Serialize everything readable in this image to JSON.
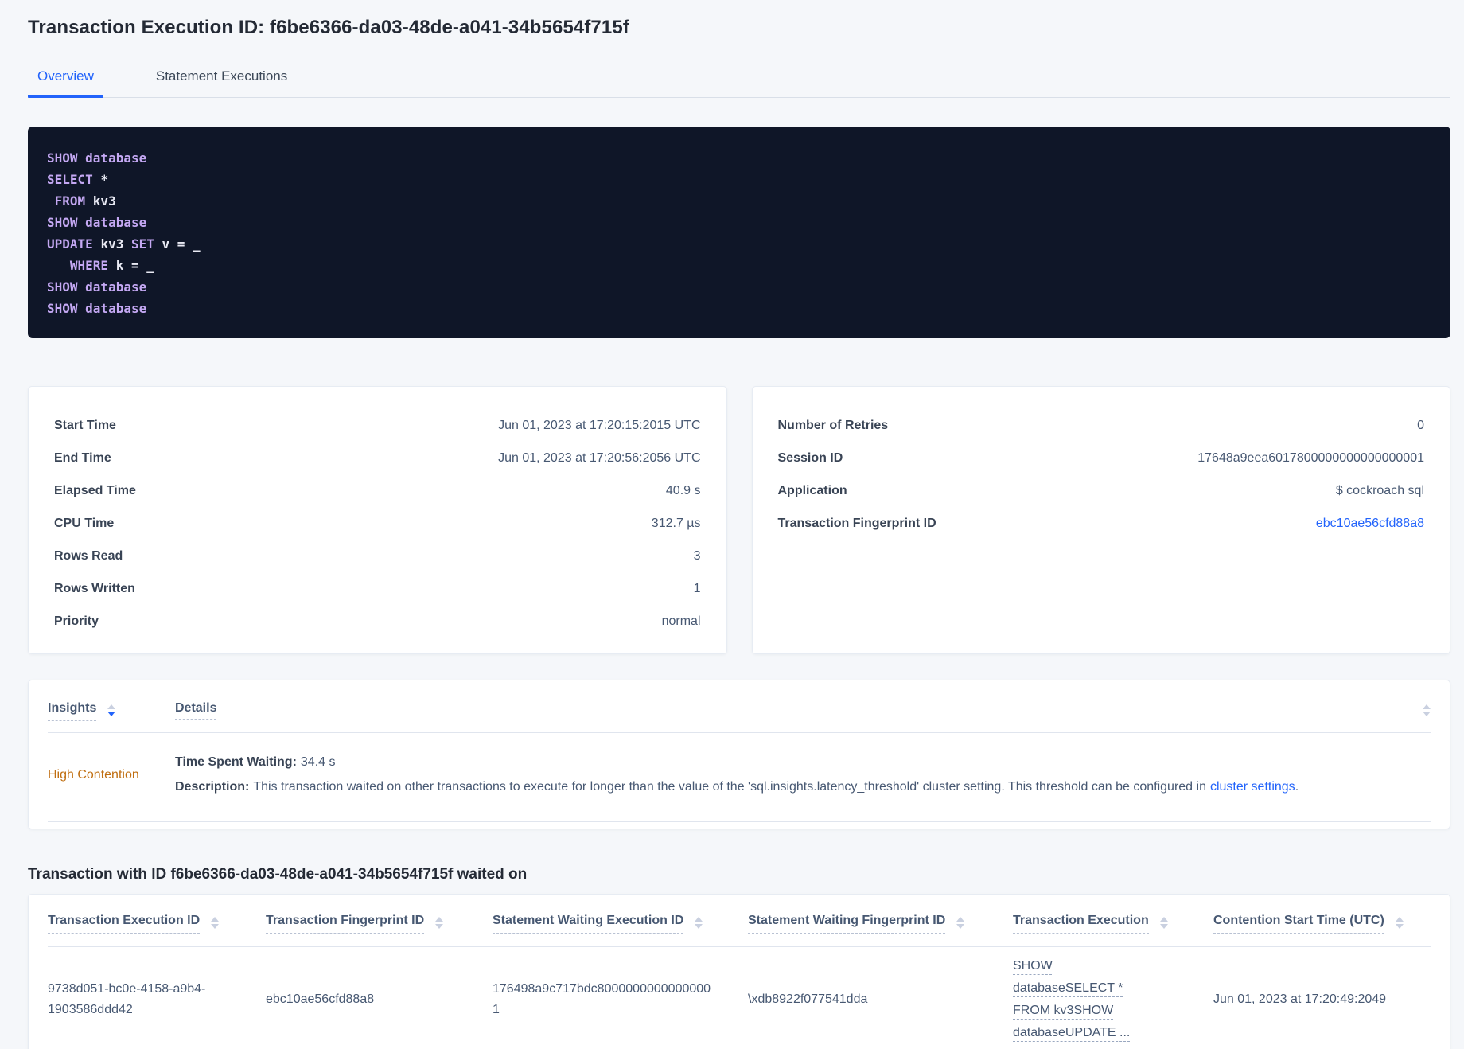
{
  "colors": {
    "accent_blue": "#2263fb",
    "warning_orange": "#c06e10",
    "code_background": "#0f1628",
    "code_keyword": "#c4a8f3",
    "code_text": "#e8e9f3"
  },
  "header": {
    "title": "Transaction Execution ID: f6be6366-da03-48de-a041-34b5654f715f"
  },
  "tabs": [
    {
      "label": "Overview"
    },
    {
      "label": "Statement Executions"
    }
  ],
  "sql": {
    "lines": [
      {
        "parts": [
          {
            "text": "SHOW database"
          }
        ]
      },
      {
        "parts": [
          {
            "text": "SELECT "
          },
          {
            "text": "*"
          }
        ]
      },
      {
        "parts": [
          {
            "text": " FROM "
          },
          {
            "text": "kv3"
          }
        ]
      },
      {
        "parts": [
          {
            "text": "SHOW database"
          }
        ]
      },
      {
        "parts": [
          {
            "text": "UPDATE "
          },
          {
            "text": "kv3 "
          },
          {
            "text": "SET "
          },
          {
            "text": "v = _"
          }
        ]
      },
      {
        "parts": [
          {
            "text": "   WHERE "
          },
          {
            "text": "k = _"
          }
        ]
      },
      {
        "parts": [
          {
            "text": "SHOW database"
          }
        ]
      },
      {
        "parts": [
          {
            "text": "SHOW database"
          }
        ]
      }
    ]
  },
  "summary": {
    "left": {
      "rows": [
        {
          "label": "Start Time",
          "value": "Jun 01, 2023 at 17:20:15:2015 UTC"
        },
        {
          "label": "End Time",
          "value": "Jun 01, 2023 at 17:20:56:2056 UTC"
        },
        {
          "label": "Elapsed Time",
          "value": "40.9 s"
        },
        {
          "label": "CPU Time",
          "value": "312.7 µs"
        },
        {
          "label": "Rows Read",
          "value": "3"
        },
        {
          "label": "Rows Written",
          "value": "1"
        },
        {
          "label": "Priority",
          "value": "normal"
        }
      ]
    },
    "right": {
      "rows": [
        {
          "label": "Number of Retries",
          "value": "0"
        },
        {
          "label": "Session ID",
          "value": "17648a9eea6017800000000000000001"
        },
        {
          "label": "Application",
          "value": "$ cockroach sql"
        }
      ],
      "fingerprint": {
        "label": "Transaction Fingerprint ID",
        "value": "ebc10ae56cfd88a8"
      }
    }
  },
  "insights": {
    "col_insights": "Insights",
    "col_details": "Details",
    "row": {
      "name": "High Contention",
      "waiting_label": "Time Spent Waiting:",
      "waiting_value": "34.4 s",
      "description_label": "Description:",
      "description_text": "This transaction waited on other transactions to execute for longer than the value of the 'sql.insights.latency_threshold' cluster setting. This threshold can be configured in",
      "description_link": "cluster settings",
      "description_suffix": "."
    }
  },
  "waited_on": {
    "heading": "Transaction with ID f6be6366-da03-48de-a041-34b5654f715f waited on",
    "columns": [
      "Transaction Execution ID",
      "Transaction Fingerprint ID",
      "Statement Waiting Execution ID",
      "Statement Waiting Fingerprint ID",
      "Transaction Execution",
      "Contention Start Time (UTC)"
    ],
    "row": {
      "transaction_execution_id": "9738d051-bc0e-4158-a9b4-1903586ddd42",
      "transaction_fingerprint_id": "ebc10ae56cfd88a8",
      "statement_waiting_execution_id": "176498a9c717bdc80000000000000001",
      "statement_waiting_fingerprint_id": "\\xdb8922f077541dda",
      "transaction_execution": "SHOW databaseSELECT * FROM kv3SHOW databaseUPDATE ...",
      "contention_start_time": "Jun 01, 2023 at 17:20:49:2049"
    }
  }
}
